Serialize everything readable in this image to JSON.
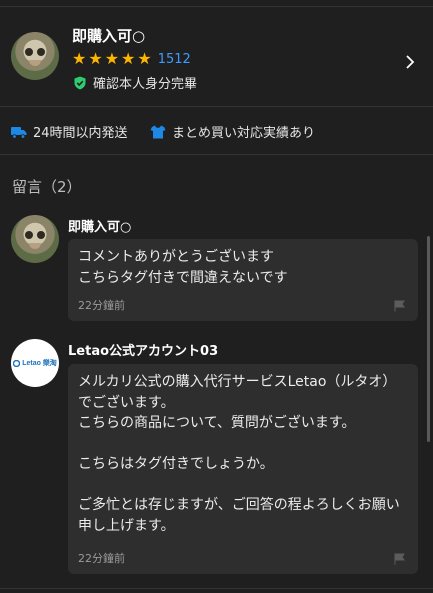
{
  "seller": {
    "name": "即購入可○",
    "rating_count": "1512",
    "stars": 5,
    "verified_label": "確認本人身分完畢"
  },
  "features": [
    {
      "icon": "truck-icon",
      "label": "24時間以内発送"
    },
    {
      "icon": "shirt-icon",
      "label": "まとめ買い対応実績あり"
    }
  ],
  "comments_section": {
    "title": "留言（2）"
  },
  "comments": [
    {
      "author": "即購入可○",
      "text": "コメントありがとうございます\nこちらタグ付きで間違えないです",
      "time": "22分鐘前",
      "avatar": "hamster"
    },
    {
      "author": "Letao公式アカウント03",
      "text": "メルカリ公式の購入代行サービスLetao（ルタオ）でございます。\nこちらの商品について、質問がございます。\n\nこちらはタグ付きでしょうか。\n\nご多忙とは存じますが、ご回答の程よろしくお願い申し上げます。",
      "time": "22分鐘前",
      "avatar": "letao-logo",
      "logo_text": "Letao 樂淘"
    }
  ],
  "colors": {
    "background": "#1f1f1f",
    "bubble": "#2e2e2e",
    "star": "#ffb400",
    "link": "#3d9bff",
    "verified": "#2ecc71",
    "feature_icon": "#1e88e5"
  }
}
